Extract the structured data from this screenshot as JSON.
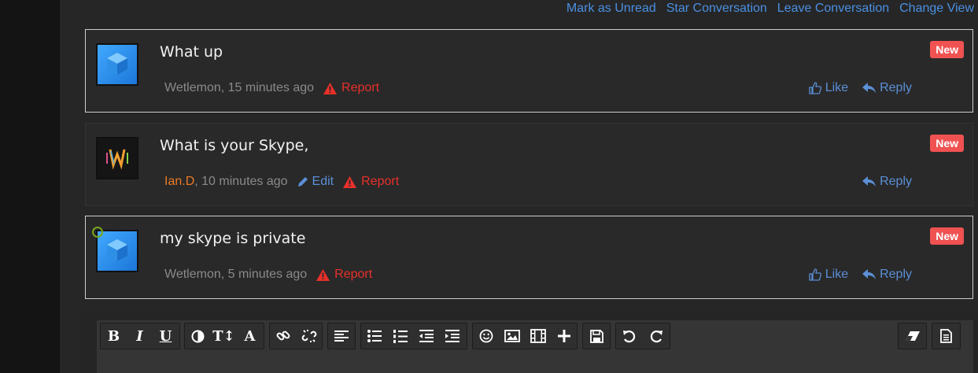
{
  "top_links": [
    "Mark as Unread",
    "Star Conversation",
    "Leave Conversation",
    "Change View"
  ],
  "messages": [
    {
      "text": "What up",
      "author": "Wetlemon",
      "time": ", 15 minutes ago",
      "badge": "New",
      "report": "Report",
      "like": "Like",
      "reply": "Reply"
    },
    {
      "text": "What is your Skype,",
      "author": "Ian.D",
      "time": ", 10 minutes ago",
      "badge": "New",
      "edit": "Edit",
      "report": "Report",
      "reply": "Reply"
    },
    {
      "text": "my skype is private",
      "author": "Wetlemon",
      "time": ", 5 minutes ago",
      "badge": "New",
      "report": "Report",
      "like": "Like",
      "reply": "Reply"
    }
  ],
  "toolbar": {
    "bold": "B",
    "italic": "I",
    "underline": "U",
    "font_size": "T↕",
    "font_color": "A"
  },
  "colors": {
    "link": "#4a90e2",
    "report": "#e8302a",
    "badge": "#f05252",
    "author_highlight": "#ec7a24"
  }
}
